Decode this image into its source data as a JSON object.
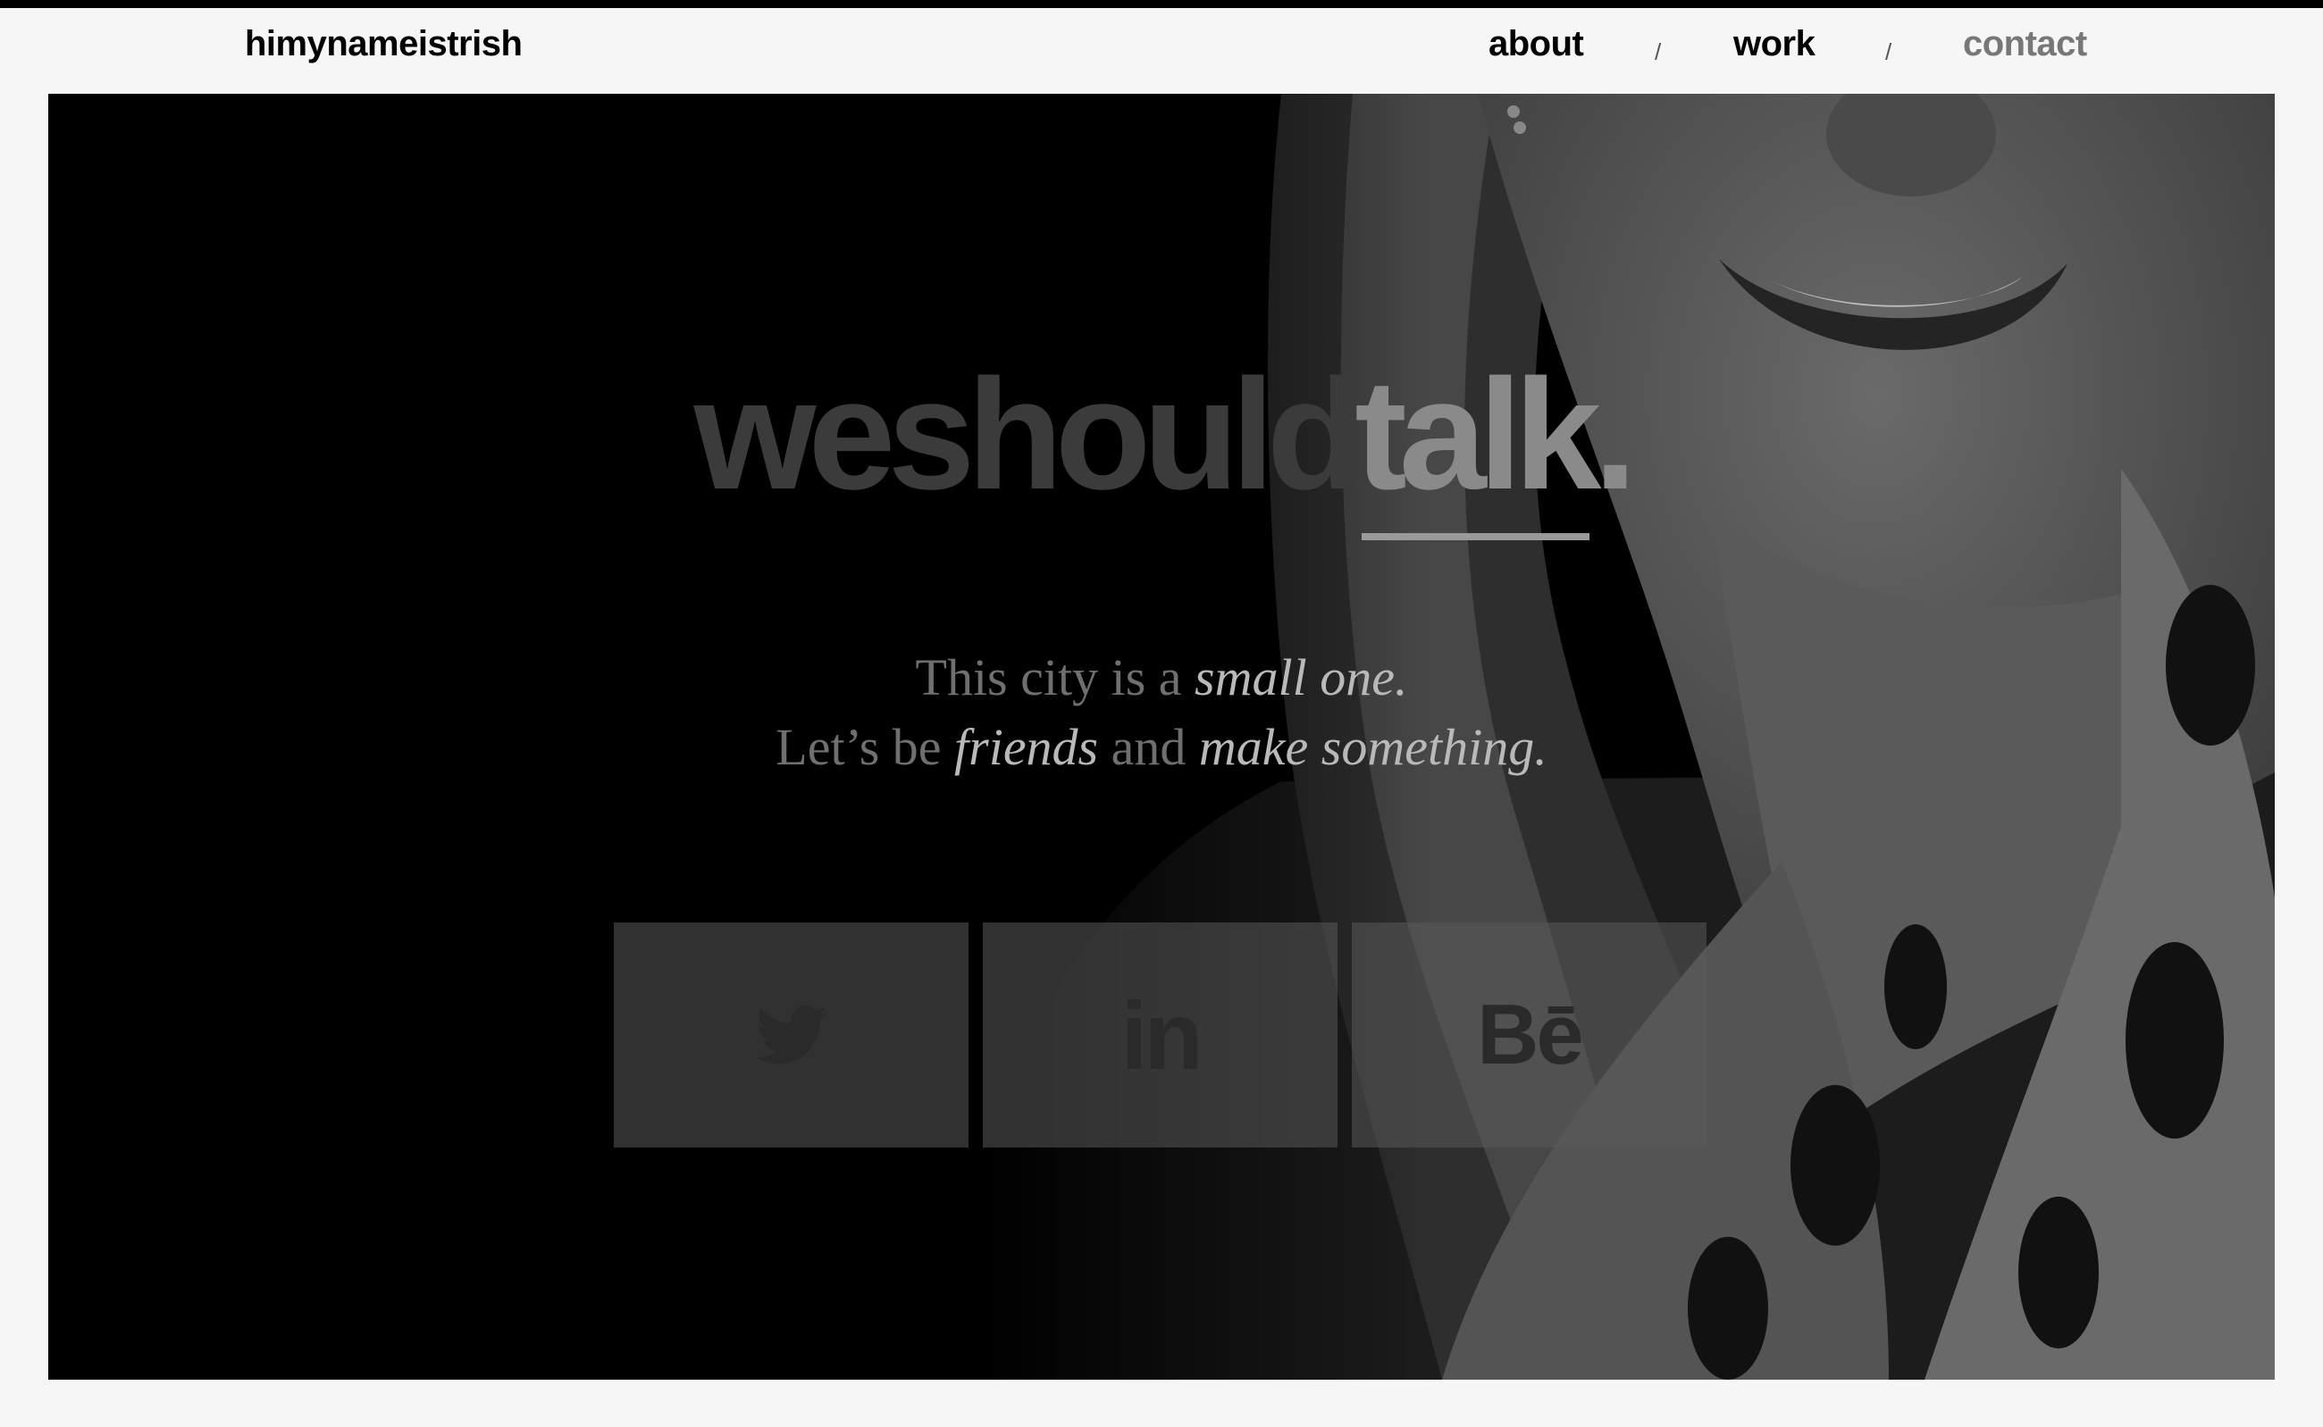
{
  "header": {
    "logo": "himynameistrish",
    "nav": [
      {
        "label": "about",
        "active": false
      },
      {
        "label": "work",
        "active": false
      },
      {
        "label": "contact",
        "active": true
      }
    ],
    "separator": "/"
  },
  "hero": {
    "headline_part1": "weshould",
    "headline_part2": "talk",
    "headline_dot": ".",
    "tagline_line1_plain": "This city is a ",
    "tagline_line1_em": "small one.",
    "tagline_line2_plain1": "Let’s be ",
    "tagline_line2_em1": "friends",
    "tagline_line2_plain2": " and ",
    "tagline_line2_em2": "make something.",
    "social": [
      {
        "name": "twitter",
        "icon": "twitter-bird-icon"
      },
      {
        "name": "linkedin",
        "icon": "linkedin-icon",
        "text": "in"
      },
      {
        "name": "behance",
        "icon": "behance-icon",
        "text": "Bē"
      }
    ]
  }
}
